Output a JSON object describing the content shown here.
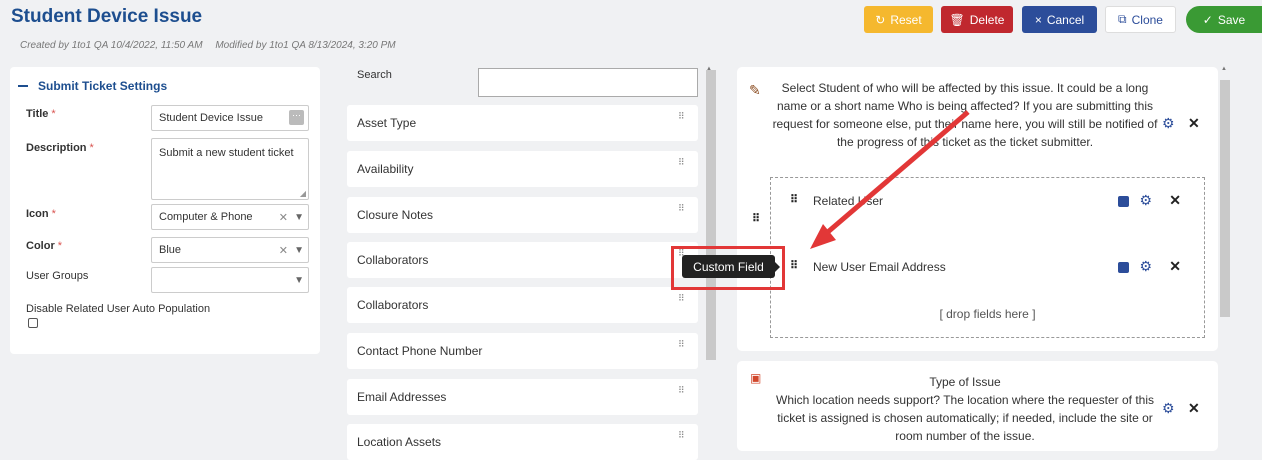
{
  "header": {
    "title": "Student Device Issue",
    "created": "Created by 1to1 QA 10/4/2022, 11:50 AM",
    "modified": "Modified by 1to1 QA 8/13/2024, 3:20 PM"
  },
  "toolbar": {
    "reset_icon": "↻",
    "reset": "Reset",
    "delete_icon": "🗑",
    "delete": "Delete",
    "cancel_icon": "×",
    "cancel": "Cancel",
    "clone_icon": "⧉",
    "clone": "Clone",
    "save_icon": "✓",
    "save": "Save",
    "colors": {
      "reset": "#f5b82e",
      "delete": "#c0282e",
      "cancel": "#2c4d9a",
      "save": "#3a9a34"
    }
  },
  "settings": {
    "heading": "Submit Ticket Settings",
    "title_label": "Title",
    "title_value": "Student Device Issue",
    "description_label": "Description",
    "description_value": "Submit a new student ticket",
    "icon_label": "Icon",
    "icon_value": "Computer & Phone",
    "color_label": "Color",
    "color_value": "Blue",
    "user_groups_label": "User Groups",
    "user_groups_value": "",
    "disable_auto_label": "Disable Related User Auto Population",
    "required_mark": "*"
  },
  "fields_panel": {
    "search_label": "Search",
    "search_value": "",
    "items": [
      {
        "label": "Asset Type"
      },
      {
        "label": "Availability"
      },
      {
        "label": "Closure Notes"
      },
      {
        "label": "Collaborators"
      },
      {
        "label": "Collaborators"
      },
      {
        "label": "Contact Phone Number"
      },
      {
        "label": "Email Addresses"
      },
      {
        "label": "Location Assets"
      }
    ]
  },
  "form_cards": {
    "card1": {
      "text": "Select Student of who will be affected by this issue. It could be a long name or a short name Who is being affected? If you are submitting this request for someone else, put their name here, you will still be notified of the progress of this ticket as the ticket submitter.",
      "fields": [
        {
          "label": "Related User"
        },
        {
          "label": "New User Email Address"
        }
      ],
      "drop_text": "[ drop fields here ]"
    },
    "card2": {
      "title": "Type of Issue",
      "text": "Which location needs support? The location where the requester of this ticket is assigned is chosen automatically; if needed, include the site or room number of the issue."
    }
  },
  "tooltip": {
    "text": "Custom Field"
  },
  "annotation_colors": {
    "arrow": "#e23737",
    "box": "#e23737"
  }
}
